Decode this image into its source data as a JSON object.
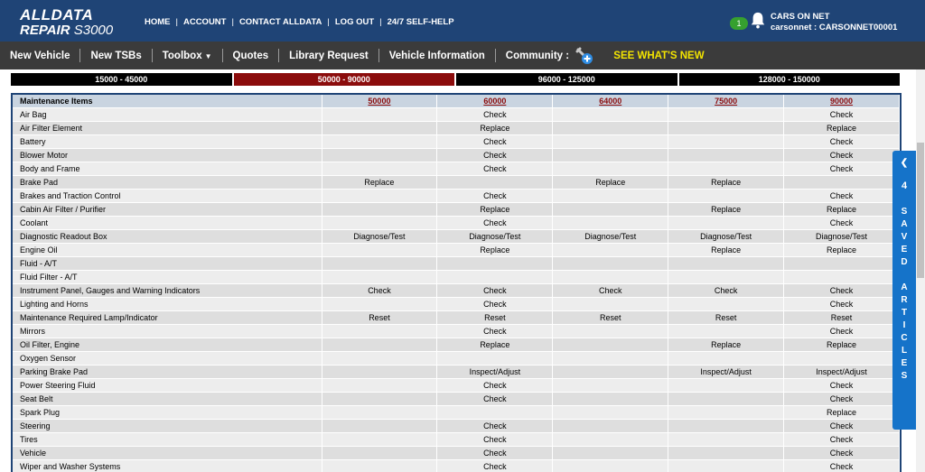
{
  "header": {
    "logo_line1": "ALLDATA",
    "logo_line2_a": "REPAIR",
    "logo_line2_b": "S3000",
    "links": [
      "HOME",
      "ACCOUNT",
      "CONTACT ALLDATA",
      "LOG OUT",
      "24/7 SELF-HELP"
    ],
    "notification_count": "1",
    "user_line1": "CARS ON NET",
    "user_line2": "carsonnet : CARSONNET00001"
  },
  "nav": {
    "new_vehicle": "New Vehicle",
    "new_tsbs": "New TSBs",
    "toolbox": "Toolbox",
    "quotes": "Quotes",
    "library_request": "Library Request",
    "vehicle_information": "Vehicle Information",
    "community": "Community",
    "community_suffix": ":",
    "whats_new": "SEE WHAT'S NEW"
  },
  "mileage_tabs": [
    {
      "label": "15000 - 45000",
      "active": false
    },
    {
      "label": "50000 - 90000",
      "active": true
    },
    {
      "label": "96000 - 125000",
      "active": false
    },
    {
      "label": "128000 - 150000",
      "active": false
    }
  ],
  "table": {
    "header_label": "Maintenance Items",
    "mileages": [
      "50000",
      "60000",
      "64000",
      "75000",
      "90000"
    ],
    "rows": [
      {
        "item": "Air Bag",
        "values": [
          "",
          "Check",
          "",
          "",
          "Check"
        ]
      },
      {
        "item": "Air Filter Element",
        "values": [
          "",
          "Replace",
          "",
          "",
          "Replace"
        ]
      },
      {
        "item": "Battery",
        "values": [
          "",
          "Check",
          "",
          "",
          "Check"
        ]
      },
      {
        "item": "Blower Motor",
        "values": [
          "",
          "Check",
          "",
          "",
          "Check"
        ]
      },
      {
        "item": "Body and Frame",
        "values": [
          "",
          "Check",
          "",
          "",
          "Check"
        ]
      },
      {
        "item": "Brake Pad",
        "values": [
          "Replace",
          "",
          "Replace",
          "Replace",
          ""
        ]
      },
      {
        "item": "Brakes and Traction Control",
        "values": [
          "",
          "Check",
          "",
          "",
          "Check"
        ]
      },
      {
        "item": "Cabin Air Filter / Purifier",
        "values": [
          "",
          "Replace",
          "",
          "Replace",
          "Replace"
        ]
      },
      {
        "item": "Coolant",
        "values": [
          "",
          "Check",
          "",
          "",
          "Check"
        ]
      },
      {
        "item": "Diagnostic Readout Box",
        "values": [
          "Diagnose/Test",
          "Diagnose/Test",
          "Diagnose/Test",
          "Diagnose/Test",
          "Diagnose/Test"
        ]
      },
      {
        "item": "Engine Oil",
        "values": [
          "",
          "Replace",
          "",
          "Replace",
          "Replace"
        ]
      },
      {
        "item": "Fluid - A/T",
        "values": [
          "",
          "",
          "",
          "",
          ""
        ]
      },
      {
        "item": "Fluid Filter - A/T",
        "values": [
          "",
          "",
          "",
          "",
          ""
        ]
      },
      {
        "item": "Instrument Panel, Gauges and Warning Indicators",
        "values": [
          "Check",
          "Check",
          "Check",
          "Check",
          "Check"
        ]
      },
      {
        "item": "Lighting and Horns",
        "values": [
          "",
          "Check",
          "",
          "",
          "Check"
        ]
      },
      {
        "item": "Maintenance Required Lamp/Indicator",
        "values": [
          "Reset",
          "Reset",
          "Reset",
          "Reset",
          "Reset"
        ]
      },
      {
        "item": "Mirrors",
        "values": [
          "",
          "Check",
          "",
          "",
          "Check"
        ]
      },
      {
        "item": "Oil Filter, Engine",
        "values": [
          "",
          "Replace",
          "",
          "Replace",
          "Replace"
        ]
      },
      {
        "item": "Oxygen Sensor",
        "values": [
          "",
          "",
          "",
          "",
          ""
        ]
      },
      {
        "item": "Parking Brake Pad",
        "values": [
          "",
          "Inspect/Adjust",
          "",
          "Inspect/Adjust",
          "Inspect/Adjust"
        ]
      },
      {
        "item": "Power Steering Fluid",
        "values": [
          "",
          "Check",
          "",
          "",
          "Check"
        ]
      },
      {
        "item": "Seat Belt",
        "values": [
          "",
          "Check",
          "",
          "",
          "Check"
        ]
      },
      {
        "item": "Spark Plug",
        "values": [
          "",
          "",
          "",
          "",
          "Replace"
        ]
      },
      {
        "item": "Steering",
        "values": [
          "",
          "Check",
          "",
          "",
          "Check"
        ]
      },
      {
        "item": "Tires",
        "values": [
          "",
          "Check",
          "",
          "",
          "Check"
        ]
      },
      {
        "item": "Vehicle",
        "values": [
          "",
          "Check",
          "",
          "",
          "Check"
        ]
      },
      {
        "item": "Wiper and Washer Systems",
        "values": [
          "",
          "Check",
          "",
          "",
          "Check"
        ]
      }
    ]
  },
  "saved_articles": {
    "count": "4",
    "label": "SAVED ARTICLES"
  },
  "colors": {
    "header_bg": "#1f4476",
    "nav_bg": "#3b3b3b",
    "active_tab": "#8b0c0c",
    "whats_new": "#f3e400",
    "saved_tab": "#1573c9"
  }
}
